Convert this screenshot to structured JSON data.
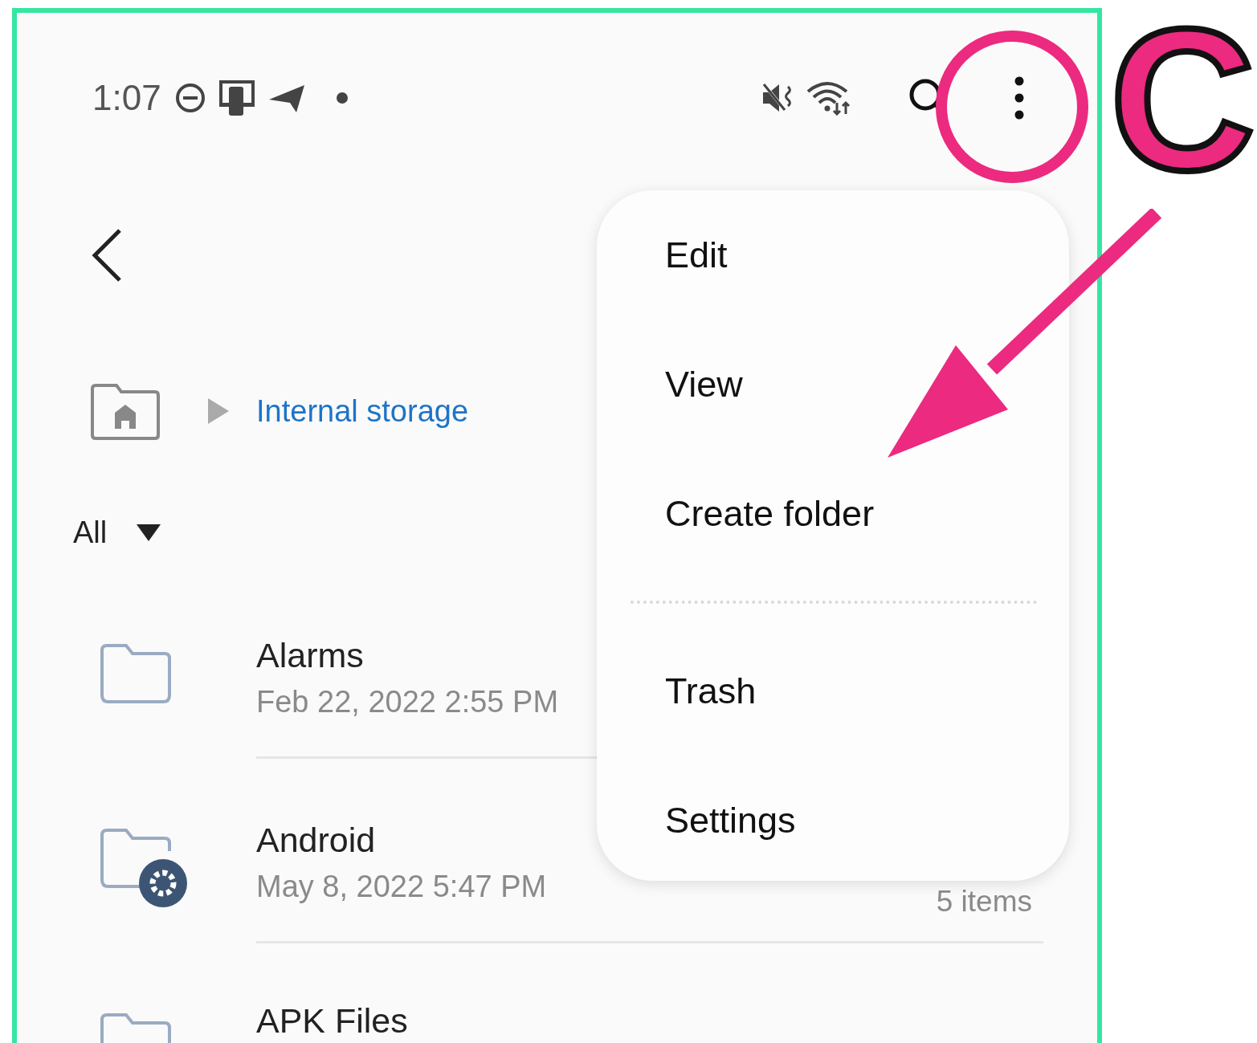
{
  "status_bar": {
    "time": "1:07"
  },
  "breadcrumb": {
    "label": "Internal storage"
  },
  "filter": {
    "label": "All"
  },
  "files": [
    {
      "kind": "folder",
      "name": "Alarms",
      "date": "Feb 22, 2022 2:55 PM"
    },
    {
      "kind": "settings_folder",
      "name": "Android",
      "date": "May 8, 2022 5:47 PM",
      "info": "5 items"
    },
    {
      "kind": "folder",
      "name": "APK Files"
    }
  ],
  "menu": {
    "groups": [
      [
        "Edit",
        "View",
        "Create folder"
      ],
      [
        "Trash",
        "Settings"
      ]
    ]
  },
  "annotation": {
    "label": "C"
  }
}
